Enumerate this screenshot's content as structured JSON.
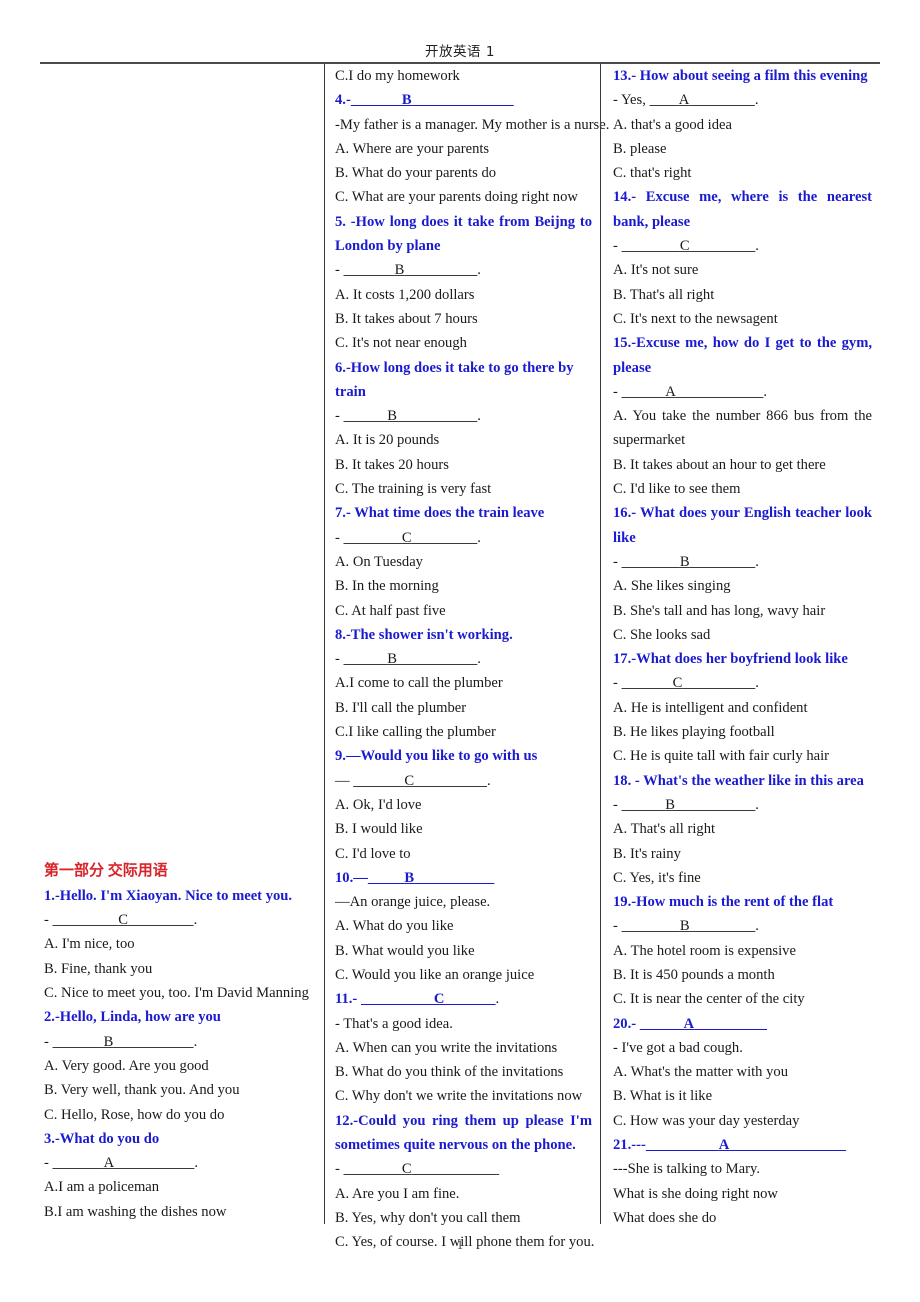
{
  "document": {
    "header_title": "开放英语 1",
    "page_number": "1"
  },
  "left_column": {
    "section_heading": "第一部分  交际用语",
    "items": [
      {
        "type": "question",
        "text": "1.-Hello. I'm Xiaoyan. Nice to meet you."
      },
      {
        "type": "blank_black",
        "prefix": "- ",
        "pad_left": "_________",
        "answer": "C",
        "pad_right": "_________",
        "suffix": "."
      },
      {
        "type": "option",
        "text": "A. I'm nice, too"
      },
      {
        "type": "option",
        "text": "B. Fine, thank you"
      },
      {
        "type": "option",
        "text": "C. Nice to meet you, too. I'm David Manning"
      },
      {
        "type": "question",
        "text": "2.-Hello, Linda, how are you"
      },
      {
        "type": "blank_black",
        "prefix": "- ",
        "pad_left": "_______",
        "answer": "B",
        "pad_right": "___________",
        "suffix": "."
      },
      {
        "type": "option",
        "text": "A. Very good. Are you good"
      },
      {
        "type": "option",
        "text": "B. Very well, thank you. And you"
      },
      {
        "type": "option",
        "text": "C. Hello, Rose, how do you do"
      },
      {
        "type": "question",
        "text": "3.-What do you do"
      },
      {
        "type": "blank_black",
        "prefix": "- ",
        "pad_left": "_______",
        "answer": "A",
        "pad_right": "___________",
        "suffix": "."
      },
      {
        "type": "option",
        "text": "A.I am a policeman"
      },
      {
        "type": "option",
        "text": "B.I am washing the dishes now"
      }
    ]
  },
  "middle_column": {
    "items": [
      {
        "type": "option",
        "text": "C.I do my homework"
      },
      {
        "type": "blank_blue",
        "prefix": "4.-",
        "pad_left": "_______",
        "answer": "B",
        "pad_right": "______________",
        "suffix": ""
      },
      {
        "type": "reply",
        "text": "-My father is a manager. My mother is a nurse."
      },
      {
        "type": "option",
        "text": "A. Where are your parents"
      },
      {
        "type": "option",
        "text": "B. What do your parents do"
      },
      {
        "type": "option",
        "text": "C. What are your parents doing right now"
      },
      {
        "type": "question_justify",
        "text": "5. -How long does it take from Beijng to London by plane"
      },
      {
        "type": "blank_black",
        "prefix": "- ",
        "pad_left": "_______",
        "answer": "B",
        "pad_right": "__________",
        "suffix": "."
      },
      {
        "type": "option",
        "text": "A. It costs 1,200 dollars"
      },
      {
        "type": "option",
        "text": "B. It takes about 7 hours"
      },
      {
        "type": "option",
        "text": "C. It's not near enough"
      },
      {
        "type": "question",
        "text": "6.-How long does it take to go there by train"
      },
      {
        "type": "blank_black",
        "prefix": "- ",
        "pad_left": "______",
        "answer": "B",
        "pad_right": "___________",
        "suffix": "."
      },
      {
        "type": "option",
        "text": "A. It is 20 pounds"
      },
      {
        "type": "option",
        "text": "B. It takes 20 hours"
      },
      {
        "type": "option",
        "text": "C. The training is very fast"
      },
      {
        "type": "question",
        "text": "7.- What time does the train leave"
      },
      {
        "type": "blank_black",
        "prefix": "- ",
        "pad_left": "________",
        "answer": "C",
        "pad_right": "_________",
        "suffix": "."
      },
      {
        "type": "option",
        "text": "A. On Tuesday"
      },
      {
        "type": "option",
        "text": "B. In the morning"
      },
      {
        "type": "option",
        "text": "C. At half past five"
      },
      {
        "type": "question",
        "text": "8.-The shower isn't working."
      },
      {
        "type": "blank_black",
        "prefix": "- ",
        "pad_left": "______",
        "answer": "B",
        "pad_right": "___________",
        "suffix": "."
      },
      {
        "type": "option",
        "text": "A.I come to call the plumber"
      },
      {
        "type": "option",
        "text": "B. I'll call the plumber"
      },
      {
        "type": "option",
        "text": "C.I like calling the plumber"
      },
      {
        "type": "question",
        "text": "9.—Would you like to go with us"
      },
      {
        "type": "blank_black",
        "prefix": "— ",
        "pad_left": "_______",
        "answer": "C",
        "pad_right": "__________",
        "suffix": "."
      },
      {
        "type": "option",
        "text": "A. Ok, I'd love"
      },
      {
        "type": "option",
        "text": "B. I would like"
      },
      {
        "type": "option",
        "text": "C. I'd love to"
      },
      {
        "type": "blank_blue",
        "prefix": "10.—",
        "pad_left": "_____",
        "answer": "B",
        "pad_right": "___________",
        "suffix": ""
      },
      {
        "type": "reply",
        "text": "—An orange juice, please."
      },
      {
        "type": "option",
        "text": "A. What do you like"
      },
      {
        "type": "option",
        "text": "B. What would you like"
      },
      {
        "type": "option",
        "text": "C. Would you like an orange juice"
      },
      {
        "type": "blank_blue",
        "prefix": "11.- ",
        "pad_left": "__________",
        "answer": "C",
        "pad_right": "_______",
        "suffix": "."
      },
      {
        "type": "reply",
        "text": "- That's a good idea."
      },
      {
        "type": "option",
        "text": "A. When can you write the invitations"
      },
      {
        "type": "option",
        "text": "B. What do you think of the invitations"
      },
      {
        "type": "option",
        "text": "C. Why don't we write the invitations now"
      },
      {
        "type": "question_justify",
        "text": "12.-Could you ring them up please I'm sometimes quite nervous on the phone."
      },
      {
        "type": "blank_black",
        "prefix": "- ",
        "pad_left": "________",
        "answer": "C",
        "pad_right": "____________",
        "suffix": ""
      },
      {
        "type": "option",
        "text": "A. Are you I am fine."
      },
      {
        "type": "option",
        "text": "B. Yes, why don't you call them"
      },
      {
        "type": "option",
        "text": "C. Yes, of course. I will phone them for you."
      }
    ]
  },
  "right_column": {
    "items": [
      {
        "type": "question",
        "text": "13.- How about seeing a film this evening"
      },
      {
        "type": "blank_black",
        "prefix": "- Yes, ",
        "pad_left": "____",
        "answer": "A",
        "pad_right": "_________",
        "suffix": "."
      },
      {
        "type": "option",
        "text": "A. that's a good idea"
      },
      {
        "type": "option",
        "text": "B. please"
      },
      {
        "type": "option",
        "text": "C. that's right"
      },
      {
        "type": "question_justify",
        "text": "14.- Excuse me, where is the nearest bank, please"
      },
      {
        "type": "blank_black",
        "prefix": "- ",
        "pad_left": "________",
        "answer": "C",
        "pad_right": "_________",
        "suffix": "."
      },
      {
        "type": "option",
        "text": "A. It's not sure"
      },
      {
        "type": "option",
        "text": "B. That's all right"
      },
      {
        "type": "option",
        "text": "C. It's next to the newsagent"
      },
      {
        "type": "question_justify",
        "text": "15.-Excuse me, how do I get to the gym, please"
      },
      {
        "type": "blank_black",
        "prefix": "- ",
        "pad_left": "______",
        "answer": "A",
        "pad_right": "____________",
        "suffix": "."
      },
      {
        "type": "option_justify",
        "text": "A. You take the number 866 bus from the supermarket"
      },
      {
        "type": "option",
        "text": "B. It takes about an hour to get there"
      },
      {
        "type": "option",
        "text": "C. I'd like to see them"
      },
      {
        "type": "question_justify",
        "text": "16.- What does your English teacher look like"
      },
      {
        "type": "blank_black",
        "prefix": "- ",
        "pad_left": "________",
        "answer": "B",
        "pad_right": "_________",
        "suffix": "."
      },
      {
        "type": "option",
        "text": "A. She likes singing"
      },
      {
        "type": "option",
        "text": "B. She's tall and has long, wavy hair"
      },
      {
        "type": "option",
        "text": "C. She looks sad"
      },
      {
        "type": "question",
        "text": "17.-What does her boyfriend look like"
      },
      {
        "type": "blank_black",
        "prefix": "- ",
        "pad_left": "_______",
        "answer": "C",
        "pad_right": "__________",
        "suffix": "."
      },
      {
        "type": "option",
        "text": "A. He is intelligent and confident"
      },
      {
        "type": "option",
        "text": "B. He likes playing football"
      },
      {
        "type": "option",
        "text": "C. He is quite tall with fair curly hair"
      },
      {
        "type": "question",
        "text": "18. - What's the weather like in this area"
      },
      {
        "type": "blank_black",
        "prefix": "- ",
        "pad_left": "______",
        "answer": "B",
        "pad_right": "___________",
        "suffix": "."
      },
      {
        "type": "option",
        "text": "A. That's all right"
      },
      {
        "type": "option",
        "text": "B. It's rainy"
      },
      {
        "type": "option",
        "text": "C. Yes, it's fine"
      },
      {
        "type": "question",
        "text": "19.-How much is the rent of the flat"
      },
      {
        "type": "blank_black",
        "prefix": "- ",
        "pad_left": "________",
        "answer": "B",
        "pad_right": "_________",
        "suffix": "."
      },
      {
        "type": "option",
        "text": "A. The hotel room is expensive"
      },
      {
        "type": "option",
        "text": "B. It is 450 pounds a month"
      },
      {
        "type": "option",
        "text": "C. It is near the center of the city"
      },
      {
        "type": "blank_blue",
        "prefix": "20.- ",
        "pad_left": "______",
        "answer": "A",
        "pad_right": "__________",
        "suffix": ""
      },
      {
        "type": "reply",
        "text": "- I've got a bad cough."
      },
      {
        "type": "option",
        "text": "A. What's the matter with you"
      },
      {
        "type": "option",
        "text": "B. What is it like"
      },
      {
        "type": "option",
        "text": "C. How was your day yesterday"
      },
      {
        "type": "blank_blue",
        "prefix": "21.---",
        "pad_left": "__________",
        "answer": "A",
        "pad_right": "________________",
        "suffix": ""
      },
      {
        "type": "reply",
        "text": "---She is talking to Mary."
      },
      {
        "type": "option",
        "text": "What is she doing right now"
      },
      {
        "type": "option",
        "text": "What does she do"
      }
    ]
  }
}
